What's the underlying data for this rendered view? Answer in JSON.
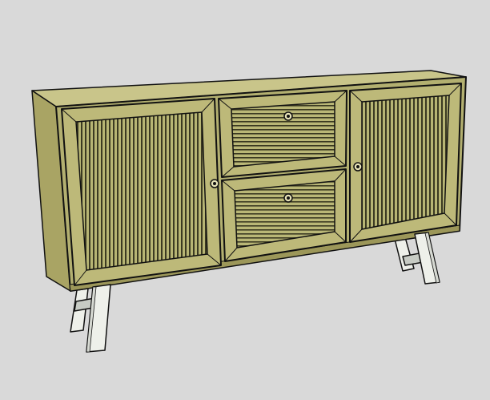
{
  "scene": {
    "subject": "sideboard-cabinet-model",
    "colors": {
      "background": "#d9d9d9",
      "wood_front": "#b7b574",
      "wood_light": "#c9c58a",
      "wood_side": "#a9a464",
      "wood_dark": "#8f8a4f",
      "slats": "#3b3a22",
      "legs": "#eef0ea",
      "leg_shadow": "#c7cbc4",
      "outline": "#111111"
    }
  }
}
